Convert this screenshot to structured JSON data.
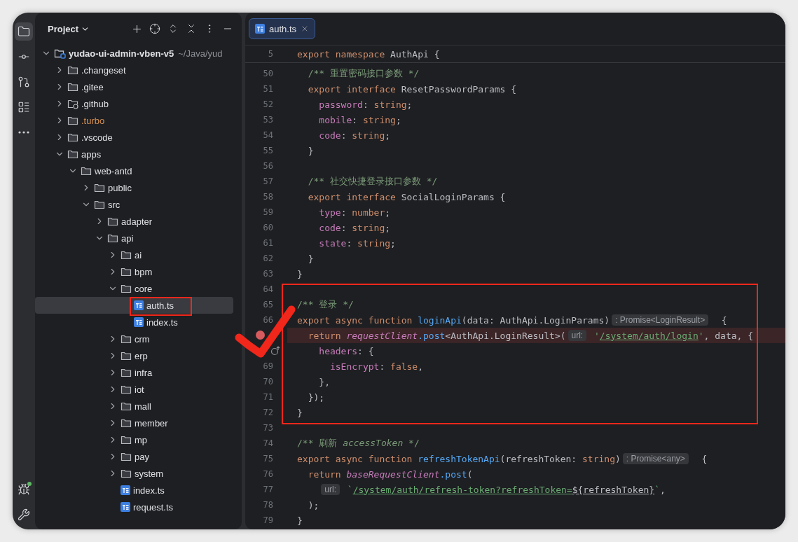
{
  "toolstrip": {
    "items": [
      {
        "kind": "folder",
        "selected": true
      },
      {
        "kind": "commit",
        "selected": false
      },
      {
        "kind": "pull-request",
        "selected": false
      },
      {
        "kind": "structure",
        "selected": false
      },
      {
        "kind": "more",
        "selected": false
      }
    ],
    "bottom_items": [
      {
        "kind": "debug",
        "selected": false
      },
      {
        "kind": "tools",
        "selected": false
      }
    ]
  },
  "project": {
    "title": "Project",
    "tree": [
      {
        "name": "yudao-ui-admin-vben-v5",
        "path": "~/Java/yud",
        "kind": "root",
        "expanded": true,
        "selected": false,
        "children": [
          {
            "name": ".changeset",
            "kind": "folder",
            "expanded": false,
            "selected": false
          },
          {
            "name": ".gitee",
            "kind": "folder",
            "expanded": false,
            "selected": false
          },
          {
            "name": ".github",
            "kind": "github-folder",
            "expanded": false,
            "selected": false
          },
          {
            "name": ".turbo",
            "kind": "excluded-folder",
            "expanded": false,
            "selected": false
          },
          {
            "name": ".vscode",
            "kind": "folder",
            "expanded": false,
            "selected": false
          },
          {
            "name": "apps",
            "kind": "folder",
            "expanded": true,
            "selected": false,
            "children": [
              {
                "name": "web-antd",
                "kind": "folder",
                "expanded": true,
                "selected": false,
                "children": [
                  {
                    "name": "public",
                    "kind": "folder",
                    "expanded": false,
                    "selected": false
                  },
                  {
                    "name": "src",
                    "kind": "folder",
                    "expanded": true,
                    "selected": false,
                    "children": [
                      {
                        "name": "adapter",
                        "kind": "folder",
                        "expanded": false,
                        "selected": false
                      },
                      {
                        "name": "api",
                        "kind": "folder",
                        "expanded": true,
                        "selected": false,
                        "children": [
                          {
                            "name": "ai",
                            "kind": "folder",
                            "expanded": false,
                            "selected": false
                          },
                          {
                            "name": "bpm",
                            "kind": "folder",
                            "expanded": false,
                            "selected": false
                          },
                          {
                            "name": "core",
                            "kind": "folder",
                            "expanded": true,
                            "selected": false,
                            "children": [
                              {
                                "name": "auth.ts",
                                "kind": "ts-file",
                                "selected": true,
                                "marked": true
                              },
                              {
                                "name": "index.ts",
                                "kind": "ts-file",
                                "selected": false,
                                "marked": false
                              }
                            ]
                          },
                          {
                            "name": "crm",
                            "kind": "folder",
                            "expanded": false,
                            "selected": false
                          },
                          {
                            "name": "erp",
                            "kind": "folder",
                            "expanded": false,
                            "selected": false
                          },
                          {
                            "name": "infra",
                            "kind": "folder",
                            "expanded": false,
                            "selected": false
                          },
                          {
                            "name": "iot",
                            "kind": "folder",
                            "expanded": false,
                            "selected": false
                          },
                          {
                            "name": "mall",
                            "kind": "folder",
                            "expanded": false,
                            "selected": false
                          },
                          {
                            "name": "member",
                            "kind": "folder",
                            "expanded": false,
                            "selected": false
                          },
                          {
                            "name": "mp",
                            "kind": "folder",
                            "expanded": false,
                            "selected": false
                          },
                          {
                            "name": "pay",
                            "kind": "folder",
                            "expanded": false,
                            "selected": false
                          },
                          {
                            "name": "system",
                            "kind": "folder",
                            "expanded": false,
                            "selected": false
                          },
                          {
                            "name": "index.ts",
                            "kind": "ts-file",
                            "selected": false,
                            "marked": false
                          },
                          {
                            "name": "request.ts",
                            "kind": "ts-file",
                            "selected": false,
                            "marked": false
                          }
                        ]
                      }
                    ]
                  }
                ]
              }
            ]
          }
        ]
      }
    ]
  },
  "editor": {
    "tabs": [
      {
        "label": "auth.ts",
        "selected": true
      }
    ],
    "sticky_line": {
      "number": "5",
      "tokens": [
        {
          "text": "export namespace ",
          "kind": "keyword"
        },
        {
          "text": "AuthApi {",
          "kind": "plain"
        }
      ]
    },
    "check_mark": true,
    "lines": [
      {
        "number": "50",
        "kind": "plain",
        "tokens": [
          {
            "text": "  /** 重置密码接口参数 */",
            "kind": "comment"
          }
        ]
      },
      {
        "number": "51",
        "kind": "plain",
        "tokens": [
          {
            "text": "  export interface ",
            "kind": "keyword"
          },
          {
            "text": "ResetPasswordParams {",
            "kind": "plain"
          }
        ]
      },
      {
        "number": "52",
        "kind": "plain",
        "tokens": [
          {
            "text": "    password",
            "kind": "property"
          },
          {
            "text": ": ",
            "kind": "plain"
          },
          {
            "text": "string",
            "kind": "keyword"
          },
          {
            "text": ";",
            "kind": "plain"
          }
        ]
      },
      {
        "number": "53",
        "kind": "plain",
        "tokens": [
          {
            "text": "    mobile",
            "kind": "property"
          },
          {
            "text": ": ",
            "kind": "plain"
          },
          {
            "text": "string",
            "kind": "keyword"
          },
          {
            "text": ";",
            "kind": "plain"
          }
        ]
      },
      {
        "number": "54",
        "kind": "plain",
        "tokens": [
          {
            "text": "    code",
            "kind": "property"
          },
          {
            "text": ": ",
            "kind": "plain"
          },
          {
            "text": "string",
            "kind": "keyword"
          },
          {
            "text": ";",
            "kind": "plain"
          }
        ]
      },
      {
        "number": "55",
        "kind": "plain",
        "tokens": [
          {
            "text": "  }",
            "kind": "plain"
          }
        ]
      },
      {
        "number": "56",
        "kind": "plain"
      },
      {
        "number": "57",
        "kind": "plain",
        "tokens": [
          {
            "text": "  /** 社交快捷登录接口参数 */",
            "kind": "comment"
          }
        ]
      },
      {
        "number": "58",
        "kind": "plain",
        "tokens": [
          {
            "text": "  export interface ",
            "kind": "keyword"
          },
          {
            "text": "SocialLoginParams {",
            "kind": "plain"
          }
        ]
      },
      {
        "number": "59",
        "kind": "plain",
        "tokens": [
          {
            "text": "    type",
            "kind": "property"
          },
          {
            "text": ": ",
            "kind": "plain"
          },
          {
            "text": "number",
            "kind": "keyword"
          },
          {
            "text": ";",
            "kind": "plain"
          }
        ]
      },
      {
        "number": "60",
        "kind": "plain",
        "tokens": [
          {
            "text": "    code",
            "kind": "property"
          },
          {
            "text": ": ",
            "kind": "plain"
          },
          {
            "text": "string",
            "kind": "keyword"
          },
          {
            "text": ";",
            "kind": "plain"
          }
        ]
      },
      {
        "number": "61",
        "kind": "plain",
        "tokens": [
          {
            "text": "    state",
            "kind": "property"
          },
          {
            "text": ": ",
            "kind": "plain"
          },
          {
            "text": "string",
            "kind": "keyword"
          },
          {
            "text": ";",
            "kind": "plain"
          }
        ]
      },
      {
        "number": "62",
        "kind": "plain",
        "tokens": [
          {
            "text": "  }",
            "kind": "plain"
          }
        ]
      },
      {
        "number": "63",
        "kind": "plain",
        "tokens": [
          {
            "text": "}",
            "kind": "plain"
          }
        ]
      },
      {
        "number": "64",
        "kind": "plain",
        "boxed": true
      },
      {
        "number": "65",
        "kind": "plain",
        "boxed": true,
        "tokens": [
          {
            "text": "/** 登录 */",
            "kind": "comment"
          }
        ]
      },
      {
        "number": "66",
        "kind": "plain",
        "boxed": true,
        "tokens": [
          {
            "text": "export async function ",
            "kind": "keyword"
          },
          {
            "text": "loginApi",
            "kind": "function"
          },
          {
            "text": "(data: AuthApi.LoginParams)",
            "kind": "plain"
          },
          {
            "text": ": Promise<LoginResult>",
            "kind": "hint"
          },
          {
            "text": "  {",
            "kind": "plain"
          }
        ]
      },
      {
        "kind": "breakpoint",
        "boxed": true,
        "tokens": [
          {
            "text": "  return ",
            "kind": "keyword"
          },
          {
            "text": "requestClient",
            "kind": "italic"
          },
          {
            "text": ".post",
            "kind": "function"
          },
          {
            "text": "<AuthApi.LoginResult>(",
            "kind": "plain"
          },
          {
            "text": "url:",
            "kind": "hint"
          },
          {
            "text": " '",
            "kind": "string"
          },
          {
            "text": "/system/auth/login",
            "kind": "url"
          },
          {
            "text": "'",
            "kind": "string"
          },
          {
            "text": ", data, {",
            "kind": "plain"
          }
        ]
      },
      {
        "kind": "implementation",
        "boxed": true,
        "tokens": [
          {
            "text": "    headers",
            "kind": "property"
          },
          {
            "text": ": {",
            "kind": "plain"
          }
        ]
      },
      {
        "number": "69",
        "kind": "plain",
        "boxed": true,
        "tokens": [
          {
            "text": "      isEncrypt",
            "kind": "property"
          },
          {
            "text": ": ",
            "kind": "plain"
          },
          {
            "text": "false",
            "kind": "keyword"
          },
          {
            "text": ",",
            "kind": "plain"
          }
        ]
      },
      {
        "number": "70",
        "kind": "plain",
        "boxed": true,
        "tokens": [
          {
            "text": "    },",
            "kind": "plain"
          }
        ]
      },
      {
        "number": "71",
        "kind": "plain",
        "boxed": true,
        "tokens": [
          {
            "text": "  });",
            "kind": "plain"
          }
        ]
      },
      {
        "number": "72",
        "kind": "plain",
        "boxed": true,
        "tokens": [
          {
            "text": "}",
            "kind": "plain"
          }
        ]
      },
      {
        "number": "73",
        "kind": "plain"
      },
      {
        "number": "74",
        "kind": "plain",
        "tokens": [
          {
            "text": "/** 刷新 ",
            "kind": "comment"
          },
          {
            "text": "accessToken",
            "kind": "comment-italic"
          },
          {
            "text": " */",
            "kind": "comment"
          }
        ]
      },
      {
        "number": "75",
        "kind": "plain",
        "tokens": [
          {
            "text": "export async function ",
            "kind": "keyword"
          },
          {
            "text": "refreshTokenApi",
            "kind": "function"
          },
          {
            "text": "(refreshToken: ",
            "kind": "plain"
          },
          {
            "text": "string",
            "kind": "keyword"
          },
          {
            "text": ")",
            "kind": "plain"
          },
          {
            "text": ": Promise<any>",
            "kind": "hint"
          },
          {
            "text": "  {",
            "kind": "plain"
          }
        ]
      },
      {
        "number": "76",
        "kind": "plain",
        "tokens": [
          {
            "text": "  return ",
            "kind": "keyword"
          },
          {
            "text": "baseRequestClient",
            "kind": "italic"
          },
          {
            "text": ".post",
            "kind": "function"
          },
          {
            "text": "(",
            "kind": "plain"
          }
        ]
      },
      {
        "number": "77",
        "kind": "plain",
        "tokens": [
          {
            "text": "    url:",
            "kind": "hint"
          },
          {
            "text": " `",
            "kind": "string"
          },
          {
            "text": "/system/auth/refresh-token?refreshToken=",
            "kind": "url"
          },
          {
            "text": "${refreshToken}",
            "kind": "url-plain"
          },
          {
            "text": "`",
            "kind": "string"
          },
          {
            "text": ",",
            "kind": "plain"
          }
        ]
      },
      {
        "number": "78",
        "kind": "plain",
        "tokens": [
          {
            "text": "  );",
            "kind": "plain"
          }
        ]
      },
      {
        "number": "79",
        "kind": "plain",
        "tokens": [
          {
            "text": "}",
            "kind": "plain"
          }
        ]
      }
    ]
  }
}
